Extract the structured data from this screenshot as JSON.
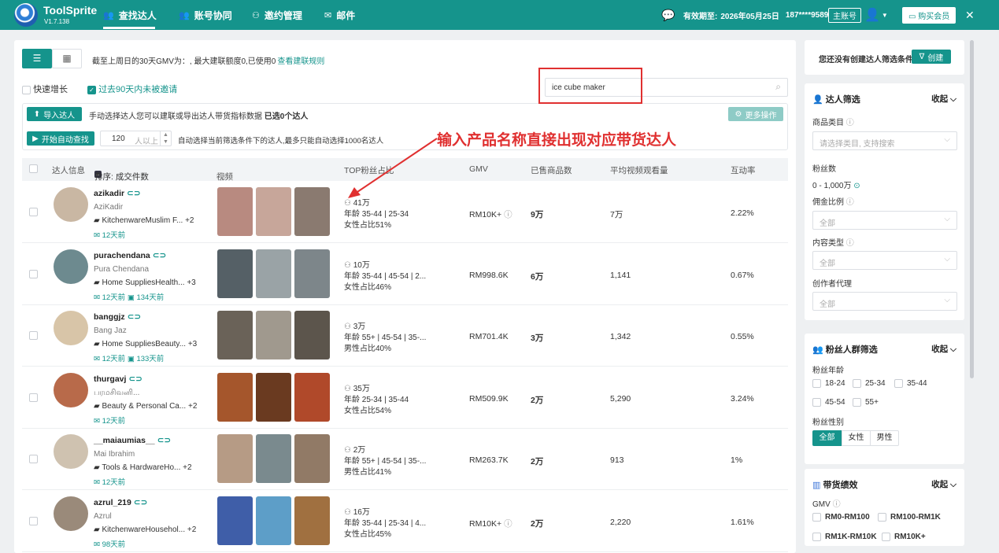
{
  "app": {
    "name": "ToolSprite",
    "version": "V1.7.138"
  },
  "nav": [
    {
      "label": "查找达人",
      "icon": "users-icon"
    },
    {
      "label": "账号协同",
      "icon": "team-icon"
    },
    {
      "label": "邀约管理",
      "icon": "invite-icon"
    },
    {
      "label": "邮件",
      "icon": "mail-icon"
    }
  ],
  "account": {
    "validity_label": "有效期至:",
    "validity_date": "2026年05月25日",
    "phone": "187****9589",
    "role": "主账号",
    "buy_label": "购买会员"
  },
  "toolbar": {
    "gmv_notice": "截至上周日的30天GMV为：, 最大建联额度0,已使用0",
    "rule_link": "查看建联规则",
    "fast_growth": "快速增长",
    "not_invited": "过去90天内未被邀请",
    "search_value": "ice cube maker"
  },
  "import": {
    "button": "导入达人",
    "hint": "手动选择达人您可以建联或导出达人带货指标数据",
    "selected": "已选0个达人",
    "more": "更多操作",
    "auto_button": "开始自动查找",
    "auto_count": "120",
    "auto_unit": "人以上",
    "auto_hint": "自动选择当前筛选条件下的达人,最多只能自动选择1000名达人"
  },
  "annotation": "输入产品名称直接出现对应带货达人",
  "table": {
    "headers": {
      "creator": "达人信息",
      "sort": "排序: 成交件数",
      "video": "视频",
      "top_fans": "TOP粉丝占比",
      "gmv": "GMV",
      "sold": "已售商品数",
      "avg_views": "平均视频观看量",
      "engagement": "互动率"
    },
    "rows": [
      {
        "handle": "azikadir",
        "name": "AziKadir",
        "category": "KitchenwareMuslim F...",
        "more": "+2",
        "days1": "12天前",
        "days2": "",
        "fans": "41万",
        "age": "年龄 35-44 | 25-34",
        "gender": "女性占比51%",
        "gmv": "RM10K+",
        "sold": "9万",
        "views": "7万",
        "eng": "2.22%"
      },
      {
        "handle": "purachendana",
        "name": "Pura Chendana",
        "category": "Home SuppliesHealth...",
        "more": "+3",
        "days1": "12天前",
        "days2": "134天前",
        "fans": "10万",
        "age": "年龄 35-44 | 45-54 | 2...",
        "gender": "女性占比46%",
        "gmv": "RM998.6K",
        "sold": "6万",
        "views": "1,141",
        "eng": "0.67%"
      },
      {
        "handle": "banggjz",
        "name": "Bang Jaz",
        "category": "Home SuppliesBeauty...",
        "more": "+3",
        "days1": "12天前",
        "days2": "133天前",
        "fans": "3万",
        "age": "年龄 55+ | 45-54 | 35-...",
        "gender": "男性占比40%",
        "gmv": "RM701.4K",
        "sold": "3万",
        "views": "1,342",
        "eng": "0.55%"
      },
      {
        "handle": "thurgavj",
        "name": "பரமசிவனி...",
        "category": "Beauty & Personal Ca...",
        "more": "+2",
        "days1": "12天前",
        "days2": "",
        "fans": "35万",
        "age": "年龄 25-34 | 35-44",
        "gender": "女性占比54%",
        "gmv": "RM509.9K",
        "sold": "2万",
        "views": "5,290",
        "eng": "3.24%"
      },
      {
        "handle": "__maiaumias__",
        "name": "Mai Ibrahim",
        "category": "Tools & HardwareHo...",
        "more": "+2",
        "days1": "12天前",
        "days2": "",
        "fans": "2万",
        "age": "年龄 55+ | 45-54 | 35-...",
        "gender": "男性占比41%",
        "gmv": "RM263.7K",
        "sold": "2万",
        "views": "913",
        "eng": "1%"
      },
      {
        "handle": "azrul_219",
        "name": "Azrul",
        "category": "KitchenwareHousehol...",
        "more": "+2",
        "days1": "98天前",
        "days2": "",
        "fans": "16万",
        "age": "年龄 35-44 | 25-34 | 4...",
        "gender": "女性占比45%",
        "gmv": "RM10K+",
        "sold": "2万",
        "views": "2,220",
        "eng": "1.61%"
      }
    ]
  },
  "sidebar": {
    "no_filter": "您还没有创建达人筛选条件",
    "create": "创建",
    "creator_filter": {
      "title": "达人筛选",
      "collapse": "收起",
      "category_label": "商品类目",
      "category_placeholder": "请选择类目, 支持搜索",
      "fans_label": "粉丝数",
      "fans_range": "0  -  1,000万",
      "commission_label": "佣金比例",
      "commission_value": "全部",
      "content_label": "内容类型",
      "content_value": "全部",
      "agency_label": "创作者代理",
      "agency_value": "全部"
    },
    "fans_filter": {
      "title": "粉丝人群筛选",
      "collapse": "收起",
      "age_label": "粉丝年龄",
      "ages": [
        "18-24",
        "25-34",
        "35-44",
        "45-54",
        "55+"
      ],
      "gender_label": "粉丝性别",
      "genders": [
        "全部",
        "女性",
        "男性"
      ]
    },
    "sales": {
      "title": "带货绩效",
      "collapse": "收起",
      "gmv_label": "GMV",
      "ranges": [
        "RM0-RM100",
        "RM100-RM1K",
        "RM1K-RM10K",
        "RM10K+"
      ]
    }
  },
  "colors": {
    "brand": "#15948c",
    "annotation": "#e03030"
  }
}
